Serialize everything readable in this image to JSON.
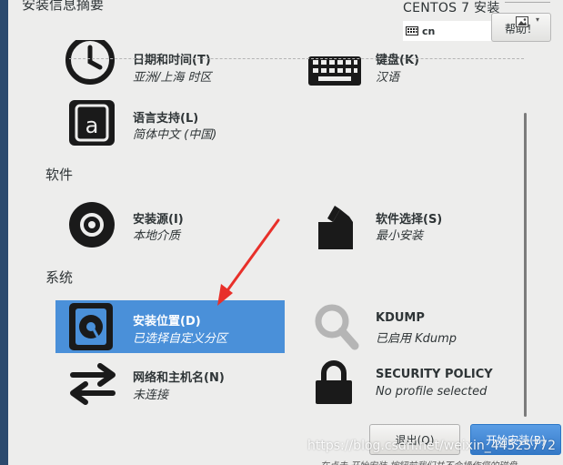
{
  "header": {
    "title": "安装信息摘要",
    "product": "CENTOS 7 安装",
    "keyboard_layout": "cn",
    "help_label": "帮助！"
  },
  "localization": {
    "datetime": {
      "title": "日期和时间(T)",
      "status": "亚洲/上海 时区",
      "icon": "clock-icon"
    },
    "keyboard": {
      "title": "键盘(K)",
      "status": "汉语",
      "icon": "keyboard-icon"
    },
    "language": {
      "title": "语言支持(L)",
      "status": "简体中文 (中国)",
      "icon": "language-icon"
    }
  },
  "software": {
    "heading": "软件",
    "source": {
      "title": "安装源(I)",
      "status": "本地介质",
      "icon": "disc-icon"
    },
    "selection": {
      "title": "软件选择(S)",
      "status": "最小安装",
      "icon": "package-icon"
    }
  },
  "system": {
    "heading": "系统",
    "destination": {
      "title": "安装位置(D)",
      "status": "已选择自定义分区",
      "icon": "harddisk-icon"
    },
    "kdump": {
      "title": "KDUMP",
      "status": "已启用 Kdump",
      "icon": "magnifier-icon"
    },
    "network": {
      "title": "网络和主机名(N)",
      "status": "未连接",
      "icon": "network-arrows-icon"
    },
    "security": {
      "title": "SECURITY POLICY",
      "status": "No profile selected",
      "icon": "lock-icon"
    }
  },
  "footer": {
    "quit_label": "退出(Q)",
    "begin_label": "开始安装(B)",
    "note": "在点击 开始安装 按钮前我们并不会操作您的磁盘",
    "watermark": "https://blog.csdn.net/weixin_44525772"
  },
  "colors": {
    "highlight": "#4a90d9",
    "primary_button": "#3478c6",
    "annotation_arrow": "#e8302a",
    "sidebar": "#2c4a6e"
  }
}
